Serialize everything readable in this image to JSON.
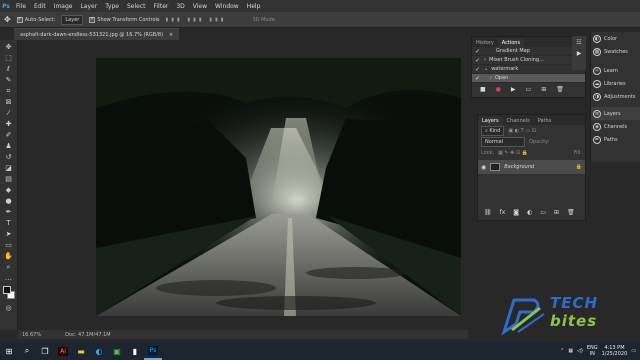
{
  "app": {
    "logo": "Ps"
  },
  "menu": [
    "File",
    "Edit",
    "Image",
    "Layer",
    "Type",
    "Select",
    "Filter",
    "3D",
    "View",
    "Window",
    "Help"
  ],
  "options": {
    "auto_select": "Auto-Select:",
    "auto_select_value": "Layer",
    "show_transform": "Show Transform Controls",
    "mode_3d": "3D Mode:"
  },
  "document": {
    "tab_title": "asphalt-dark-dawn-endless-531321.jpg @ 16.7% (RGB/8)",
    "close": "×"
  },
  "status": {
    "zoom": "16.67%",
    "doc": "Doc: 47.1M/47.1M"
  },
  "actions_panel": {
    "tabs": [
      "History",
      "Actions"
    ],
    "rows": [
      {
        "label": "Gradient Map",
        "checked": true
      },
      {
        "label": "Mixer Brush Cloning...",
        "checked": true
      },
      {
        "label": "watermark",
        "checked": true
      },
      {
        "label": "Open",
        "checked": true,
        "highlight": true
      }
    ]
  },
  "layers_panel": {
    "tabs": [
      "Layers",
      "Channels",
      "Paths"
    ],
    "kind": "Kind",
    "blend": "Normal",
    "opacity": "Opacity:",
    "lock": "Lock:",
    "fill": "Fill:",
    "layer_name": "Background"
  },
  "dock": {
    "items": [
      "Color",
      "Swatches",
      "Learn",
      "Libraries",
      "Adjustments",
      "Layers",
      "Channels",
      "Paths"
    ]
  },
  "watermark": {
    "line1": "TECH",
    "line2": "bites"
  },
  "taskbar": {
    "lang": "ENG",
    "region": "IN",
    "time": "4:13 PM",
    "date": "1/25/2020"
  },
  "colors": {
    "accent": "#31a8ff",
    "logo_blue": "#2b6cd4",
    "logo_green": "#8bc63e"
  }
}
